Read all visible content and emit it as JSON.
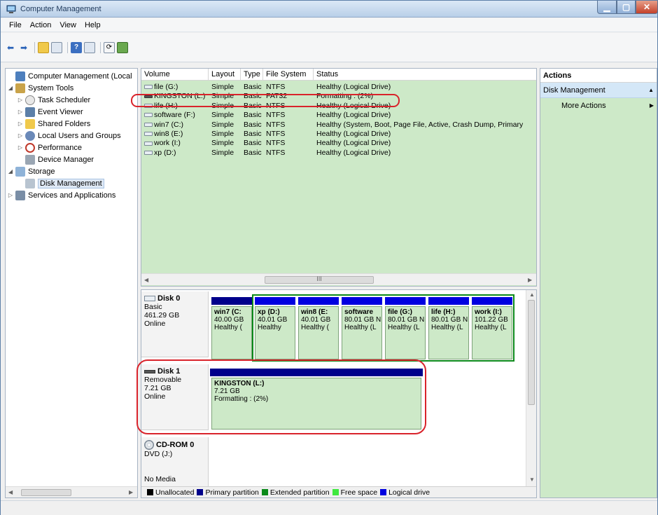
{
  "window": {
    "title": "Computer Management"
  },
  "menu": [
    "File",
    "Action",
    "View",
    "Help"
  ],
  "tree": {
    "root": "Computer Management (Local",
    "system_tools": "System Tools",
    "task_scheduler": "Task Scheduler",
    "event_viewer": "Event Viewer",
    "shared_folders": "Shared Folders",
    "local_users": "Local Users and Groups",
    "performance": "Performance",
    "device_manager": "Device Manager",
    "storage": "Storage",
    "disk_management": "Disk Management",
    "services": "Services and Applications"
  },
  "volumes": {
    "headers": [
      "Volume",
      "Layout",
      "Type",
      "File System",
      "Status"
    ],
    "rows": [
      {
        "volume": "file (G:)",
        "layout": "Simple",
        "type": "Basic",
        "fs": "NTFS",
        "status": "Healthy (Logical Drive)"
      },
      {
        "volume": "KINGSTON (L:)",
        "layout": "Simple",
        "type": "Basic",
        "fs": "FAT32",
        "status": "Formatting : (2%)"
      },
      {
        "volume": "life (H:)",
        "layout": "Simple",
        "type": "Basic",
        "fs": "NTFS",
        "status": "Healthy (Logical Drive)"
      },
      {
        "volume": "software (F:)",
        "layout": "Simple",
        "type": "Basic",
        "fs": "NTFS",
        "status": "Healthy (Logical Drive)"
      },
      {
        "volume": "win7 (C:)",
        "layout": "Simple",
        "type": "Basic",
        "fs": "NTFS",
        "status": "Healthy (System, Boot, Page File, Active, Crash Dump, Primary"
      },
      {
        "volume": "win8 (E:)",
        "layout": "Simple",
        "type": "Basic",
        "fs": "NTFS",
        "status": "Healthy (Logical Drive)"
      },
      {
        "volume": "work (I:)",
        "layout": "Simple",
        "type": "Basic",
        "fs": "NTFS",
        "status": "Healthy (Logical Drive)"
      },
      {
        "volume": "xp (D:)",
        "layout": "Simple",
        "type": "Basic",
        "fs": "NTFS",
        "status": "Healthy (Logical Drive)"
      }
    ],
    "hscroll_thumb": "III"
  },
  "disks": {
    "disk0": {
      "name": "Disk 0",
      "kind": "Basic",
      "size": "461.29 GB",
      "state": "Online"
    },
    "disk1": {
      "name": "Disk 1",
      "kind": "Removable",
      "size": "7.21 GB",
      "state": "Online"
    },
    "cdrom": {
      "name": "CD-ROM 0",
      "kind": "DVD (J:)",
      "state": "No Media"
    },
    "disk0_parts": [
      {
        "name": "win7 (C:",
        "size": "40.00 GB",
        "status": "Healthy (",
        "kind": "primary"
      },
      {
        "name": "xp (D:)",
        "size": "40.01 GB",
        "status": "Healthy",
        "kind": "logical"
      },
      {
        "name": "win8 (E:",
        "size": "40.01 GB",
        "status": "Healthy (",
        "kind": "logical"
      },
      {
        "name": "software",
        "size": "80.01 GB N",
        "status": "Healthy (L",
        "kind": "logical"
      },
      {
        "name": "file (G:)",
        "size": "80.01 GB N",
        "status": "Healthy (L",
        "kind": "logical"
      },
      {
        "name": "life (H:)",
        "size": "80.01 GB N",
        "status": "Healthy (L",
        "kind": "logical"
      },
      {
        "name": "work (I:)",
        "size": "101.22 GB",
        "status": "Healthy (L",
        "kind": "logical"
      }
    ],
    "disk1_part": {
      "name": "KINGSTON (L:)",
      "size": "7.21 GB",
      "status": "Formatting : (2%)"
    }
  },
  "legend": [
    {
      "label": "Unallocated",
      "color": "#000000"
    },
    {
      "label": "Primary partition",
      "color": "#00008b"
    },
    {
      "label": "Extended partition",
      "color": "#0b8a1a"
    },
    {
      "label": "Free space",
      "color": "#3fe83f"
    },
    {
      "label": "Logical drive",
      "color": "#0000e0"
    }
  ],
  "actions": {
    "title": "Actions",
    "section": "Disk Management",
    "more": "More Actions"
  },
  "colors": {
    "highlight_ring": "#d9232b",
    "volume_bg": "#cde9c8",
    "primary": "#00008b",
    "logical": "#0000e0",
    "extended": "#0b8a1a"
  }
}
